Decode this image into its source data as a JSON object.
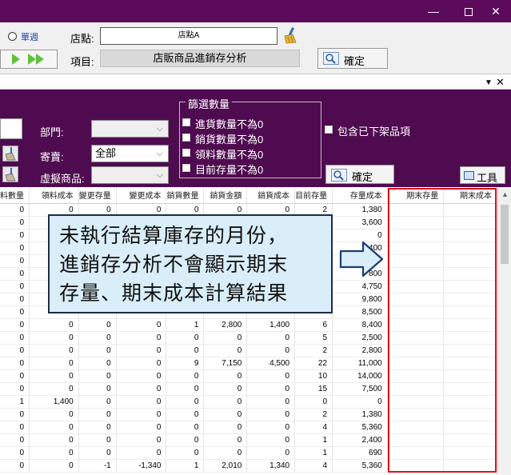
{
  "window": {
    "min_glyph": "—",
    "close_glyph": "✕"
  },
  "top": {
    "radio_label": "單週",
    "store_label": "店點:",
    "store_value": "店點A",
    "item_label": "項目:",
    "item_value": "店販商品進銷存分析",
    "confirm_label": "確定"
  },
  "subbar": {
    "dropdown_glyph": "▼",
    "close_glyph": "✕"
  },
  "filters": {
    "dept_label": "部門:",
    "dept_value": "",
    "consign_label": "寄賣:",
    "consign_value": "全部",
    "virtual_label": "虛擬商品:",
    "virtual_value": "",
    "group_title": "篩選數量",
    "checks": [
      "進貨數量不為0",
      "銷貨數量不為0",
      "領料數量不為0",
      "目前存量不為0"
    ],
    "include_removed": "包含已下架品項",
    "confirm_label": "確定",
    "tools_label": "工具"
  },
  "grid": {
    "columns": [
      "料數量",
      "領料成本",
      "變更存量",
      "變更成本",
      "銷貨數量",
      "銷貨金額",
      "銷貨成本",
      "目前存量",
      "存量成本",
      "期末存量",
      "期末成本"
    ],
    "rows": [
      [
        "0",
        "0",
        "0",
        "0",
        "0",
        "0",
        "0",
        "2",
        "1,380",
        "",
        ""
      ],
      [
        "0",
        "",
        "",
        "",
        "",
        "",
        "",
        "",
        "3,600",
        "",
        ""
      ],
      [
        "0",
        "",
        "",
        "",
        "",
        "",
        "",
        "",
        "0",
        "",
        ""
      ],
      [
        "0",
        "",
        "",
        "",
        "",
        "",
        "",
        "",
        "400",
        "",
        ""
      ],
      [
        "0",
        "",
        "",
        "",
        "",
        "",
        "",
        "",
        "",
        "",
        ""
      ],
      [
        "0",
        "",
        "",
        "",
        "",
        "",
        "",
        "",
        "800",
        "",
        ""
      ],
      [
        "0",
        "",
        "",
        "",
        "",
        "",
        "",
        "",
        "4,750",
        "",
        ""
      ],
      [
        "0",
        "",
        "",
        "",
        "",
        "",
        "",
        "",
        "9,800",
        "",
        ""
      ],
      [
        "0",
        "",
        "",
        "",
        "",
        "",
        "",
        "",
        "8,500",
        "",
        ""
      ],
      [
        "0",
        "0",
        "0",
        "0",
        "1",
        "2,800",
        "1,400",
        "6",
        "8,400",
        "",
        ""
      ],
      [
        "0",
        "0",
        "0",
        "0",
        "0",
        "0",
        "0",
        "5",
        "2,500",
        "",
        ""
      ],
      [
        "0",
        "0",
        "0",
        "0",
        "0",
        "0",
        "0",
        "2",
        "2,800",
        "",
        ""
      ],
      [
        "0",
        "0",
        "0",
        "0",
        "9",
        "7,150",
        "4,500",
        "22",
        "11,000",
        "",
        ""
      ],
      [
        "0",
        "0",
        "0",
        "0",
        "0",
        "0",
        "0",
        "10",
        "14,000",
        "",
        ""
      ],
      [
        "0",
        "0",
        "0",
        "0",
        "0",
        "0",
        "0",
        "15",
        "7,500",
        "",
        ""
      ],
      [
        "1",
        "1,400",
        "0",
        "0",
        "0",
        "0",
        "0",
        "0",
        "0",
        "",
        ""
      ],
      [
        "0",
        "0",
        "0",
        "0",
        "0",
        "0",
        "0",
        "2",
        "1,380",
        "",
        ""
      ],
      [
        "0",
        "0",
        "0",
        "0",
        "0",
        "0",
        "0",
        "4",
        "5,360",
        "",
        ""
      ],
      [
        "0",
        "0",
        "0",
        "0",
        "0",
        "0",
        "0",
        "1",
        "2,400",
        "",
        ""
      ],
      [
        "0",
        "0",
        "0",
        "0",
        "0",
        "0",
        "0",
        "1",
        "690",
        "",
        ""
      ],
      [
        "0",
        "0",
        "-1",
        "-1,340",
        "1",
        "2,010",
        "1,340",
        "4",
        "5,360",
        "",
        ""
      ]
    ]
  },
  "callout": {
    "lines": [
      "未執行結算庫存的月份，",
      "進銷存分析不會顯示期末",
      "存量、期末成本計算結果"
    ]
  },
  "colors": {
    "titlebar": "#5c0b5c",
    "panel": "#4f0b50",
    "highlight": "#e0121a",
    "callout_bg": "#d9eef8"
  }
}
